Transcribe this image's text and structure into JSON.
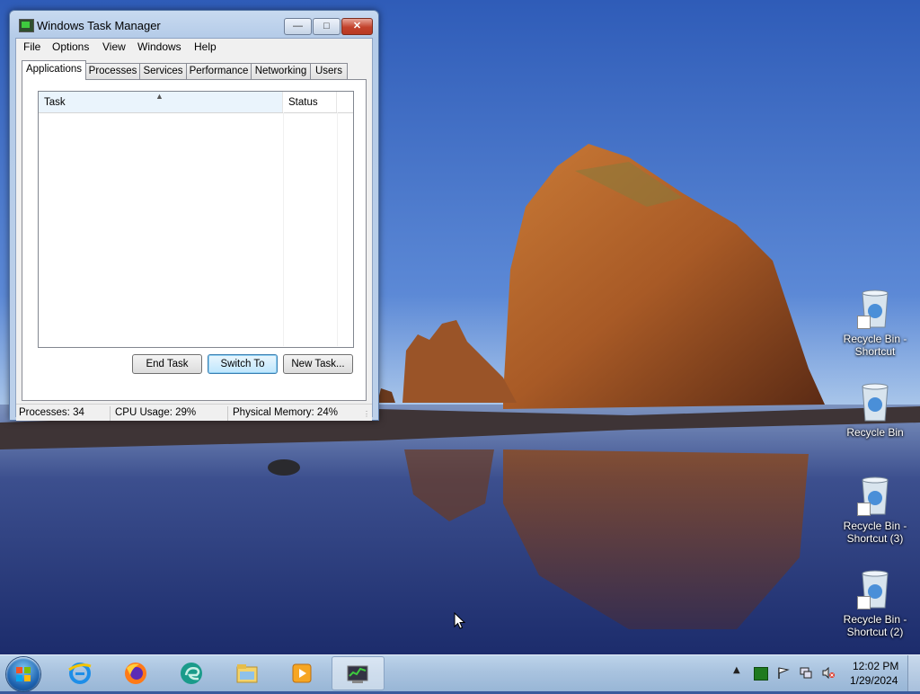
{
  "window": {
    "title": "Windows Task Manager",
    "menu": [
      "File",
      "Options",
      "View",
      "Windows",
      "Help"
    ],
    "tabs": [
      "Applications",
      "Processes",
      "Services",
      "Performance",
      "Networking",
      "Users"
    ],
    "active_tab": "Applications",
    "list": {
      "columns": [
        "Task",
        "Status"
      ],
      "rows": []
    },
    "buttons": {
      "end_task": "End Task",
      "switch_to": "Switch To",
      "new_task": "New Task..."
    },
    "status": {
      "processes": "Processes: 34",
      "cpu": "CPU Usage: 29%",
      "memory": "Physical Memory: 24%"
    }
  },
  "desktop_icons": [
    {
      "line1": "Recycle Bin -",
      "line2": "Shortcut",
      "shortcut": true
    },
    {
      "line1": "Recycle Bin",
      "line2": "",
      "shortcut": false
    },
    {
      "line1": "Recycle Bin -",
      "line2": "Shortcut (3)",
      "shortcut": true
    },
    {
      "line1": "Recycle Bin -",
      "line2": "Shortcut (2)",
      "shortcut": true
    }
  ],
  "taskbar": {
    "pinned": [
      "internet-explorer-icon",
      "firefox-icon",
      "edge-icon",
      "file-explorer-icon",
      "media-player-icon",
      "task-manager-icon"
    ],
    "clock_time": "12:02 PM",
    "clock_date": "1/29/2024"
  },
  "colors": {
    "sky": "#3f6cc4",
    "rock": "#b5672e",
    "taskbar": "#a9c3df",
    "close_button": "#c2412b"
  }
}
